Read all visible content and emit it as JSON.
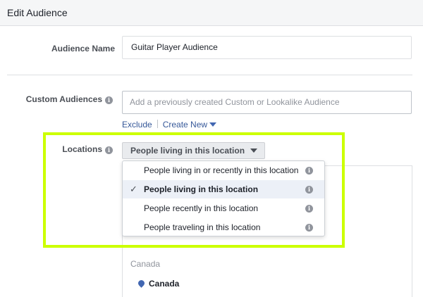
{
  "header": {
    "title": "Edit Audience"
  },
  "audience_name": {
    "label": "Audience Name",
    "value": "Guitar Player Audience"
  },
  "custom_audiences": {
    "label": "Custom Audiences",
    "info_icon": "info-icon",
    "placeholder": "Add a previously created Custom or Lookalike Audience",
    "exclude_label": "Exclude",
    "create_new_label": "Create New"
  },
  "locations": {
    "label": "Locations",
    "dropdown_value": "People living in this location",
    "menu_items": [
      {
        "label": "People living in or recently in this location",
        "selected": false
      },
      {
        "label": "People living in this location",
        "selected": true
      },
      {
        "label": "People recently in this location",
        "selected": false
      },
      {
        "label": "People traveling in this location",
        "selected": false
      }
    ],
    "country_group": "Canada",
    "country_item": "Canada"
  },
  "colors": {
    "highlight": "#ccff00",
    "link": "#365899",
    "selected_row": "#ecf0f7"
  }
}
